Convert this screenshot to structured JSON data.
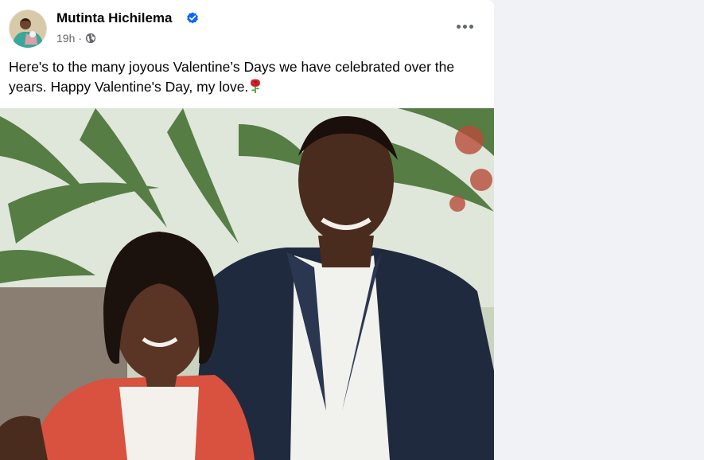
{
  "post": {
    "author_name": "Mutinta Hichilema",
    "verified_icon": "verified-badge-icon",
    "timestamp": "19h",
    "separator": "·",
    "audience_icon": "globe-icon",
    "more_icon": "more-options-icon",
    "text": "Here's to the many joyous Valentine’s Days we have celebrated over the years. Happy Valentine's Day, my love.",
    "emoji_icon": "rose-emoji-icon",
    "photo_icon": "photo-couple-icon"
  },
  "colors": {
    "verified_blue": "#0866ff",
    "secondary_text": "#65676b",
    "page_background": "#f0f2f5"
  }
}
